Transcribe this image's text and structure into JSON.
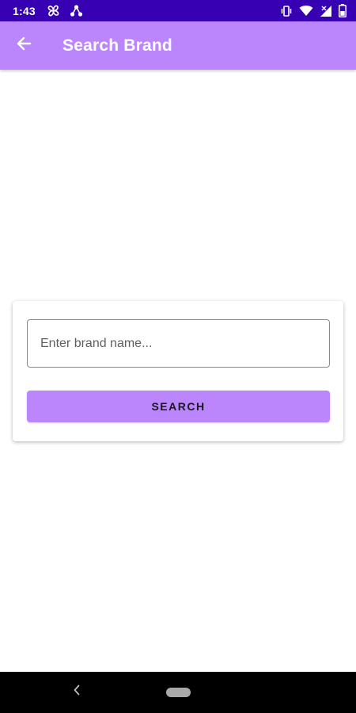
{
  "status_bar": {
    "time": "1:43",
    "left_icons": [
      "pinwheel-icon",
      "network-icon"
    ],
    "right_icons": [
      "vibrate-icon",
      "wifi-icon",
      "signal-icon",
      "battery-icon"
    ],
    "background": "#3700b3"
  },
  "app_bar": {
    "title": "Search Brand",
    "back_icon": "arrow-back-icon",
    "background": "#bb86fc"
  },
  "search": {
    "input_placeholder": "Enter brand name...",
    "input_value": "",
    "button_label": "SEARCH",
    "button_color": "#bb86fc"
  },
  "nav_bar": {
    "icons": [
      "nav-back-icon",
      "home-pill-icon"
    ],
    "background": "#000000"
  }
}
